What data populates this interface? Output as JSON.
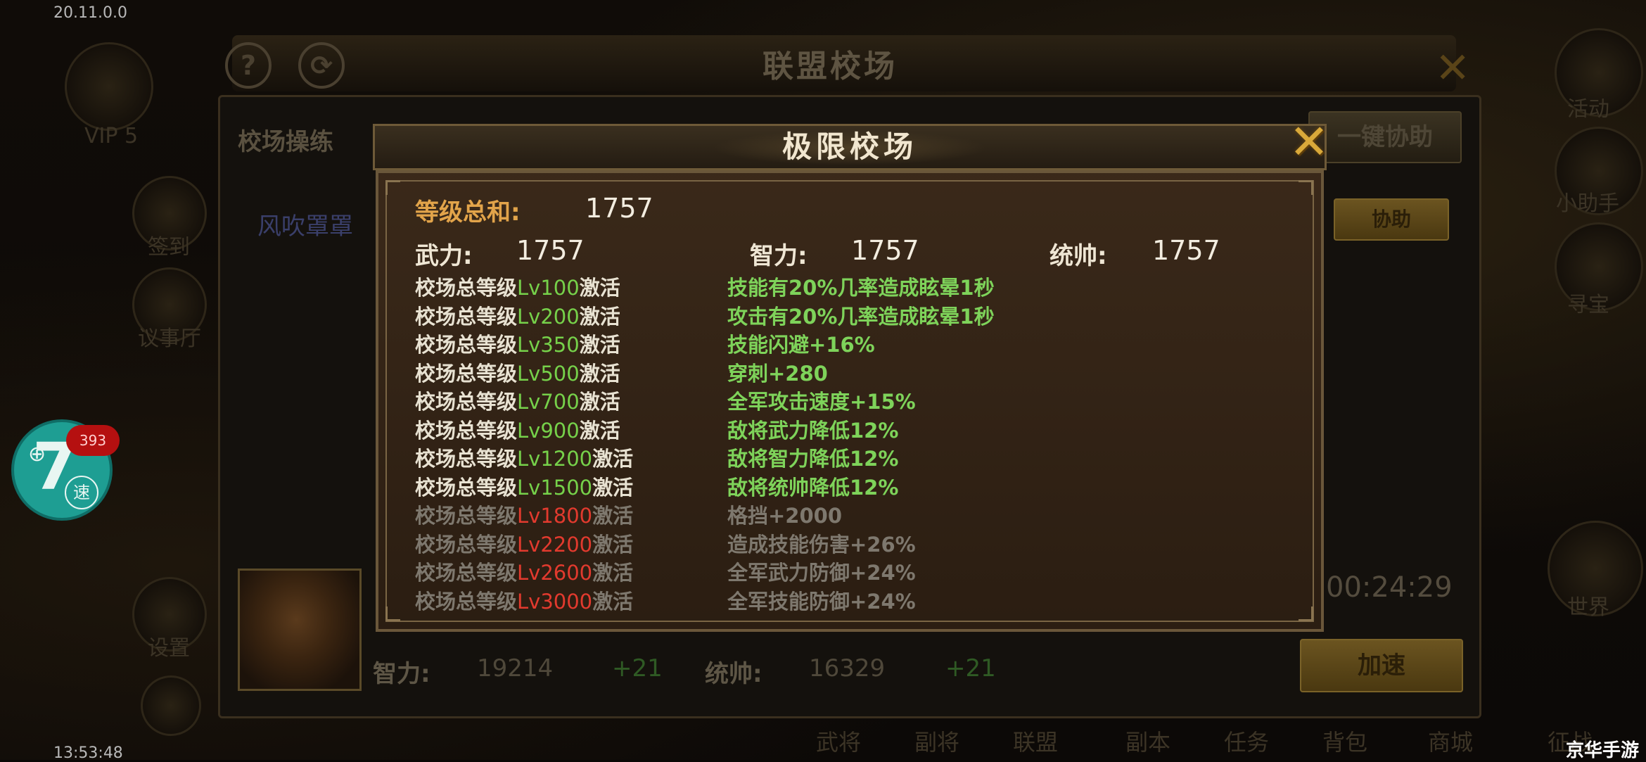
{
  "status": {
    "version": "20.11.0.0",
    "clock": "13:53:48"
  },
  "watermark": "京华手游",
  "background": {
    "title": "联盟校场",
    "tab_label": "校场操练",
    "member_name": "风吹罩罩",
    "one_click_assist": "一键协助",
    "assist": "协助",
    "timer": "00:24:29",
    "speed_up": "加速",
    "vip": "VIP 5",
    "intel_label": "智力:",
    "intel_value": "19214",
    "intel_bonus": "+21",
    "command_label": "统帅:",
    "command_value": "16329",
    "command_bonus": "+21",
    "side_left": [
      "签到",
      "议事厅",
      "设置"
    ],
    "side_right": [
      "活动",
      "小助手",
      "寻宝",
      "世界"
    ],
    "bottom_tabs": [
      "武将",
      "副将",
      "联盟",
      "副本",
      "任务",
      "背包",
      "商城",
      "征战"
    ]
  },
  "float_widget": {
    "badge_count": "393",
    "speed_char": "速"
  },
  "modal": {
    "title": "极限校场",
    "total_label": "等级总和:",
    "total_value": "1757",
    "force_label": "武力:",
    "force_value": "1757",
    "intel_label": "智力:",
    "intel_value": "1757",
    "command_label": "统帅:",
    "command_value": "1757",
    "rows": [
      {
        "prefix": "校场总等级",
        "level": "Lv100",
        "suffix": "激活",
        "effect": "技能有20%几率造成眩晕1秒",
        "active": true
      },
      {
        "prefix": "校场总等级",
        "level": "Lv200",
        "suffix": "激活",
        "effect": "攻击有20%几率造成眩晕1秒",
        "active": true
      },
      {
        "prefix": "校场总等级",
        "level": "Lv350",
        "suffix": "激活",
        "effect": "技能闪避+16%",
        "active": true
      },
      {
        "prefix": "校场总等级",
        "level": "Lv500",
        "suffix": "激活",
        "effect": "穿刺+280",
        "active": true
      },
      {
        "prefix": "校场总等级",
        "level": "Lv700",
        "suffix": "激活",
        "effect": "全军攻击速度+15%",
        "active": true
      },
      {
        "prefix": "校场总等级",
        "level": "Lv900",
        "suffix": "激活",
        "effect": "敌将武力降低12%",
        "active": true
      },
      {
        "prefix": "校场总等级",
        "level": "Lv1200",
        "suffix": "激活",
        "effect": "敌将智力降低12%",
        "active": true
      },
      {
        "prefix": "校场总等级",
        "level": "Lv1500",
        "suffix": "激活",
        "effect": "敌将统帅降低12%",
        "active": true
      },
      {
        "prefix": "校场总等级",
        "level": "Lv1800",
        "suffix": "激活",
        "effect": "格挡+2000",
        "active": false
      },
      {
        "prefix": "校场总等级",
        "level": "Lv2200",
        "suffix": "激活",
        "effect": "造成技能伤害+26%",
        "active": false
      },
      {
        "prefix": "校场总等级",
        "level": "Lv2600",
        "suffix": "激活",
        "effect": "全军武力防御+24%",
        "active": false
      },
      {
        "prefix": "校场总等级",
        "level": "Lv3000",
        "suffix": "激活",
        "effect": "全军技能防御+24%",
        "active": false
      }
    ]
  },
  "colors": {
    "active_effect": "#7ed35a",
    "locked_level": "#e23a2e",
    "locked_text": "#7e786e",
    "gold_label": "#e2a44a"
  }
}
